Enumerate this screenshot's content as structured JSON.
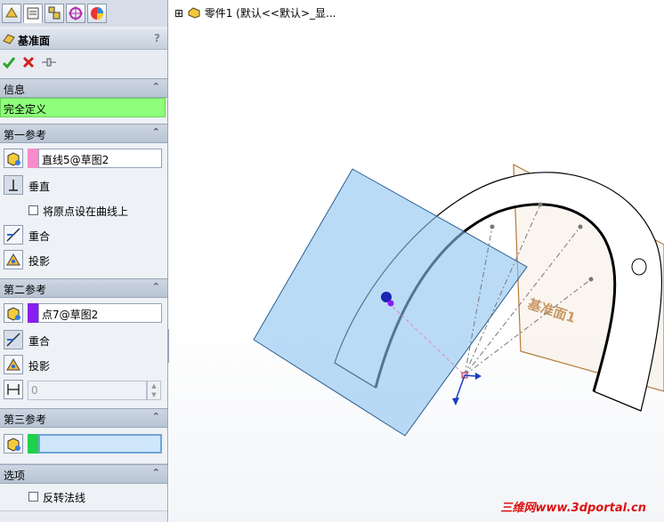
{
  "feature_title": "基准面",
  "help_glyph": "?",
  "tree": {
    "expand": "⊞",
    "label": "零件1 (默认<<默认>_显..."
  },
  "sections": {
    "info": {
      "header": "信息",
      "status": "完全定义"
    },
    "first_ref": {
      "header": "第一参考",
      "selection": "直线5@草图2",
      "selection_color": "#f98bc9",
      "constraint": "垂直",
      "checkbox_label": "将原点设在曲线上",
      "opt_coincident": "重合",
      "opt_project": "投影"
    },
    "second_ref": {
      "header": "第二参考",
      "selection": "点7@草图2",
      "selection_color": "#8a1df1",
      "opt_coincident": "重合",
      "opt_project": "投影",
      "distance_value": "0"
    },
    "third_ref": {
      "header": "第三参考",
      "selection_color": "#1fd04a"
    },
    "options": {
      "header": "选项",
      "checkbox_label": "反转法线"
    }
  },
  "plane_label": "基准面1",
  "watermark": "三维网www.3dportal.cn"
}
